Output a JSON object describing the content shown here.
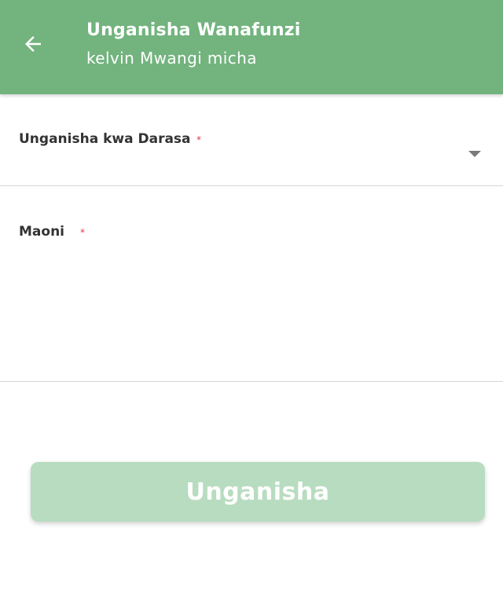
{
  "header": {
    "title": "Unganisha Wanafunzi",
    "subtitle": "kelvin Mwangi micha",
    "back_icon": "arrow-left-icon",
    "background_color": "#72b37e"
  },
  "form": {
    "class_select": {
      "label": "Unganisha kwa Darasa",
      "required_mark": "*",
      "value": ""
    },
    "comments": {
      "label": "Maoni",
      "required_mark": "*",
      "value": ""
    }
  },
  "actions": {
    "submit_label": "Unganisha",
    "submit_color": "#b8dcc0"
  }
}
